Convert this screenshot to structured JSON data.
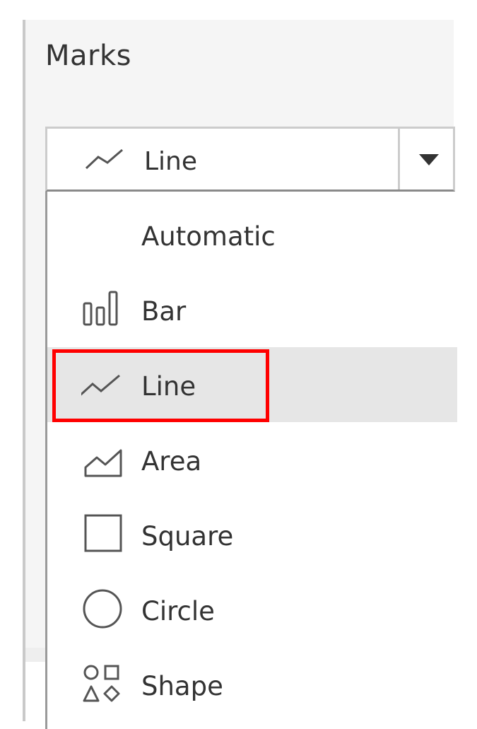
{
  "marks_panel": {
    "title": "Marks",
    "dropdown": {
      "selected_label": "Line",
      "selected_icon": "line-mark-icon",
      "arrow_icon": "caret-down-icon"
    },
    "menu_items": [
      {
        "label": "Automatic",
        "icon": "none"
      },
      {
        "label": "Bar",
        "icon": "bar-mark-icon"
      },
      {
        "label": "Line",
        "icon": "line-mark-icon",
        "selected": true
      },
      {
        "label": "Area",
        "icon": "area-mark-icon"
      },
      {
        "label": "Square",
        "icon": "square-mark-icon"
      },
      {
        "label": "Circle",
        "icon": "circle-mark-icon"
      },
      {
        "label": "Shape",
        "icon": "shape-mark-icon"
      }
    ]
  },
  "colors": {
    "highlight_border": "#ff0000",
    "selected_row_bg": "#e6e6e6",
    "icon_stroke": "#555555"
  }
}
